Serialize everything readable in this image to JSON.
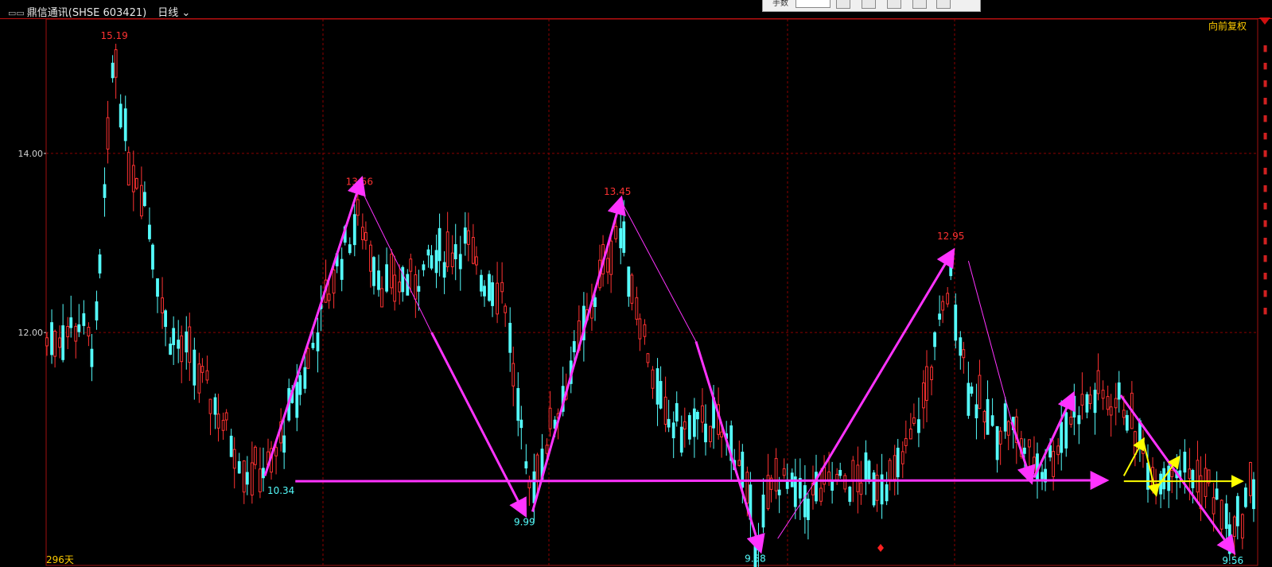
{
  "header": {
    "window_icon": "window-toggle-icon",
    "stock_title": "鼎信通讯(SHSE 603421)",
    "period_label": "日线",
    "period_icon": "chevron-down-icon",
    "toolstrip_label": "手数"
  },
  "badge": {
    "adjust_mode": "向前复权"
  },
  "footer": {
    "day_count": "296天"
  },
  "colors": {
    "up": "#ff3232",
    "down": "#54fcfc",
    "grid": "#8b0000",
    "trend": "#ff33ff",
    "yellow": "#ffff00",
    "high_label": "#ff3232",
    "low_label": "#54fcfc"
  },
  "chart_data": {
    "type": "candlestick",
    "count": 296,
    "ylim": [
      9.4,
      15.5
    ],
    "y_ticks": [
      "14.00",
      "12.00"
    ],
    "y_tick_values": [
      14.0,
      12.0
    ],
    "annotations": [
      {
        "label": "15.19",
        "bar": 42,
        "price": 15.19,
        "kind": "high"
      },
      {
        "label": "10.34",
        "bar": 146,
        "price": 10.34,
        "kind": "low"
      },
      {
        "label": "13.56",
        "bar": 195,
        "price": 13.56,
        "kind": "high"
      },
      {
        "label": "9.99",
        "bar": 298,
        "price": 9.99,
        "kind": "low"
      },
      {
        "label": "13.45",
        "bar": 356,
        "price": 13.45,
        "kind": "high"
      },
      {
        "label": "9.58",
        "bar": 442,
        "price": 9.58,
        "kind": "low"
      },
      {
        "label": "12.95",
        "bar": 564,
        "price": 12.95,
        "kind": "high"
      },
      {
        "label": "9.56",
        "bar": 740,
        "price": 9.56,
        "kind": "low"
      }
    ],
    "anchors": [
      {
        "i": 0,
        "p": 11.9
      },
      {
        "i": 20,
        "p": 12.1
      },
      {
        "i": 30,
        "p": 11.8
      },
      {
        "i": 42,
        "p": 15.19
      },
      {
        "i": 50,
        "p": 14.0
      },
      {
        "i": 60,
        "p": 13.6
      },
      {
        "i": 75,
        "p": 12.0
      },
      {
        "i": 90,
        "p": 11.7
      },
      {
        "i": 110,
        "p": 11.0
      },
      {
        "i": 125,
        "p": 10.45
      },
      {
        "i": 140,
        "p": 10.5
      },
      {
        "i": 160,
        "p": 11.5
      },
      {
        "i": 180,
        "p": 12.7
      },
      {
        "i": 195,
        "p": 13.3
      },
      {
        "i": 210,
        "p": 12.5
      },
      {
        "i": 230,
        "p": 12.6
      },
      {
        "i": 250,
        "p": 12.9
      },
      {
        "i": 262,
        "p": 13.0
      },
      {
        "i": 270,
        "p": 12.6
      },
      {
        "i": 285,
        "p": 12.5
      },
      {
        "i": 300,
        "p": 10.2
      },
      {
        "i": 320,
        "p": 11.2
      },
      {
        "i": 340,
        "p": 12.3
      },
      {
        "i": 356,
        "p": 13.2
      },
      {
        "i": 370,
        "p": 12.2
      },
      {
        "i": 385,
        "p": 11.0
      },
      {
        "i": 400,
        "p": 10.9
      },
      {
        "i": 415,
        "p": 11.0
      },
      {
        "i": 432,
        "p": 10.6
      },
      {
        "i": 442,
        "p": 9.65
      },
      {
        "i": 455,
        "p": 10.4
      },
      {
        "i": 470,
        "p": 10.1
      },
      {
        "i": 490,
        "p": 10.3
      },
      {
        "i": 510,
        "p": 10.35
      },
      {
        "i": 530,
        "p": 10.4
      },
      {
        "i": 545,
        "p": 11.1
      },
      {
        "i": 564,
        "p": 12.6
      },
      {
        "i": 575,
        "p": 11.4
      },
      {
        "i": 590,
        "p": 10.9
      },
      {
        "i": 600,
        "p": 11.0
      },
      {
        "i": 610,
        "p": 10.7
      },
      {
        "i": 622,
        "p": 10.45
      },
      {
        "i": 640,
        "p": 11.1
      },
      {
        "i": 655,
        "p": 11.3
      },
      {
        "i": 672,
        "p": 11.2
      },
      {
        "i": 690,
        "p": 10.4
      },
      {
        "i": 705,
        "p": 10.5
      },
      {
        "i": 725,
        "p": 10.3
      },
      {
        "i": 740,
        "p": 9.7
      },
      {
        "i": 752,
        "p": 10.3
      }
    ],
    "trendlines": [
      {
        "from": [
          136,
          10.4
        ],
        "to": [
          196,
          13.7
        ],
        "style": "thick"
      },
      {
        "from": [
          196,
          13.6
        ],
        "to": [
          240,
          12.0
        ],
        "style": "thin"
      },
      {
        "from": [
          240,
          12.0
        ],
        "to": [
          298,
          9.98
        ],
        "style": "thick"
      },
      {
        "from": [
          303,
          10.0
        ],
        "to": [
          358,
          13.48
        ],
        "style": "thick"
      },
      {
        "from": [
          358,
          13.48
        ],
        "to": [
          405,
          11.9
        ],
        "style": "thin"
      },
      {
        "from": [
          405,
          11.9
        ],
        "to": [
          445,
          9.58
        ],
        "style": "thick"
      },
      {
        "from": [
          456,
          9.7
        ],
        "to": [
          478,
          10.3
        ],
        "style": "thin"
      },
      {
        "from": [
          478,
          10.3
        ],
        "to": [
          565,
          12.9
        ],
        "style": "thick"
      },
      {
        "from": [
          575,
          12.8
        ],
        "to": [
          602,
          11.0
        ],
        "style": "thin"
      },
      {
        "from": [
          602,
          11.0
        ],
        "to": [
          614,
          10.35
        ],
        "style": "thick"
      },
      {
        "from": [
          616,
          10.38
        ],
        "to": [
          640,
          11.3
        ],
        "style": "thick"
      },
      {
        "from": [
          670,
          11.3
        ],
        "to": [
          740,
          9.56
        ],
        "style": "thick"
      },
      {
        "from": [
          155,
          10.34
        ],
        "to": [
          660,
          10.35
        ],
        "style": "arrow"
      }
    ],
    "yellow_lines": [
      {
        "from": [
          672,
          10.34
        ],
        "to": [
          745,
          10.34
        ]
      },
      {
        "from": [
          672,
          10.4
        ],
        "to": [
          684,
          10.8
        ]
      },
      {
        "from": [
          684,
          10.8
        ],
        "to": [
          692,
          10.2
        ]
      },
      {
        "from": [
          692,
          10.25
        ],
        "to": [
          706,
          10.6
        ]
      }
    ]
  }
}
